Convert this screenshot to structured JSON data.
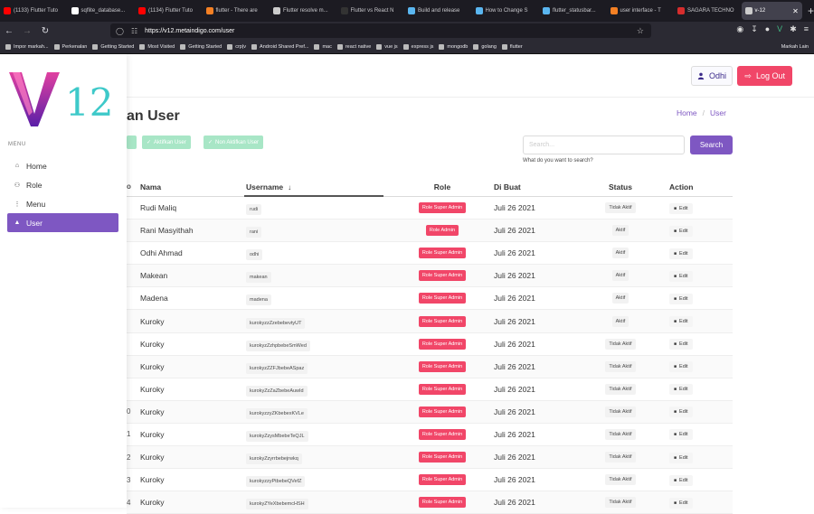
{
  "browser": {
    "tabs": [
      {
        "label": "(1133) Flutter Tuto",
        "color": "#ff0000"
      },
      {
        "label": "sqflite_database...",
        "color": "#ffffff"
      },
      {
        "label": "(1134) Flutter Tuto",
        "color": "#ff0000"
      },
      {
        "label": "flutter - There are",
        "color": "#f48024"
      },
      {
        "label": "Flutter resolve m...",
        "color": "#cccccc"
      },
      {
        "label": "Flutter vs React N",
        "color": "#333333"
      },
      {
        "label": "Build and release",
        "color": "#5ab6f0"
      },
      {
        "label": "How to Change S",
        "color": "#5ab6f0"
      },
      {
        "label": "flutter_statusbar...",
        "color": "#5ab6f0"
      },
      {
        "label": "user interface - T",
        "color": "#f48024"
      },
      {
        "label": "SAGARA TECHNO",
        "color": "#d62d2d"
      },
      {
        "label": "v-12",
        "color": "#cccccc",
        "active": true
      }
    ],
    "url": "https://v12.metaindigo.com/user",
    "bookmarks": [
      "Impor markah...",
      "Perkenalan",
      "Getting Started",
      "Most Visited",
      "Getting Started",
      "crp|v",
      "Android Shared Pref...",
      "mac",
      "react native",
      "vue js",
      "express js",
      "mongodb",
      "golang",
      "flutter"
    ],
    "bookmarks_other": "Markah Lain"
  },
  "brand": {
    "logo_text": "V12"
  },
  "header": {
    "user_label": "Odhi",
    "logout_label": "Log Out"
  },
  "sidebar": {
    "menu_label": "MENU",
    "items": [
      {
        "label": "Home",
        "icon": "home-icon",
        "active": false
      },
      {
        "label": "Role",
        "icon": "role-icon",
        "active": false
      },
      {
        "label": "Menu",
        "icon": "menu-dots-icon",
        "active": false
      },
      {
        "label": "User",
        "icon": "user-icon",
        "active": true
      }
    ]
  },
  "page": {
    "title": "an User",
    "breadcrumb": [
      "Home",
      "User"
    ],
    "actions": [
      "",
      "Aktifkan User",
      "Non Aktifkan User"
    ],
    "search_placeholder": "Search...",
    "search_button": "Search",
    "search_help": "What do you want to search?"
  },
  "table": {
    "columns": [
      "o",
      "Nama",
      "Username",
      "Role",
      "Di Buat",
      "Status",
      "Action"
    ],
    "rows": [
      {
        "no": "",
        "nama": "Rudi Maliq",
        "username": "rudi",
        "role": "Role Super Admin",
        "dibuat": "Juli 26 2021",
        "status": "Tidak Aktif",
        "action": "Edit"
      },
      {
        "no": "",
        "nama": "Rani Masyithah",
        "username": "rani",
        "role": "Role Admin",
        "dibuat": "Juli 26 2021",
        "status": "Aktif",
        "action": "Edit"
      },
      {
        "no": "",
        "nama": "Odhi Ahmad",
        "username": "odhi",
        "role": "Role Super Admin",
        "dibuat": "Juli 26 2021",
        "status": "Aktif",
        "action": "Edit"
      },
      {
        "no": "",
        "nama": "Makean",
        "username": "makean",
        "role": "Role Super Admin",
        "dibuat": "Juli 26 2021",
        "status": "Aktif",
        "action": "Edit"
      },
      {
        "no": "",
        "nama": "Madena",
        "username": "madena",
        "role": "Role Super Admin",
        "dibuat": "Juli 26 2021",
        "status": "Aktif",
        "action": "Edit"
      },
      {
        "no": "",
        "nama": "Kuroky",
        "username": "kurokyzzZzebebevtyUT",
        "role": "Role Super Admin",
        "dibuat": "Juli 26 2021",
        "status": "Aktif",
        "action": "Edit"
      },
      {
        "no": "",
        "nama": "Kuroky",
        "username": "kurokyzZzhpbebeSmWed",
        "role": "Role Super Admin",
        "dibuat": "Juli 26 2021",
        "status": "Tidak Aktif",
        "action": "Edit"
      },
      {
        "no": "",
        "nama": "Kuroky",
        "username": "kurokyzZZFJbebeASpaz",
        "role": "Role Super Admin",
        "dibuat": "Juli 26 2021",
        "status": "Tidak Aktif",
        "action": "Edit"
      },
      {
        "no": "",
        "nama": "Kuroky",
        "username": "kurokyZzZaZbebeAuwId",
        "role": "Role Super Admin",
        "dibuat": "Juli 26 2021",
        "status": "Tidak Aktif",
        "action": "Edit"
      },
      {
        "no": "0",
        "nama": "Kuroky",
        "username": "kurokyzzyZKbebexKVLe",
        "role": "Role Super Admin",
        "dibuat": "Juli 26 2021",
        "status": "Tidak Aktif",
        "action": "Edit"
      },
      {
        "no": "1",
        "nama": "Kuroky",
        "username": "kurokyZzysMbebeTeQJL",
        "role": "Role Super Admin",
        "dibuat": "Juli 26 2021",
        "status": "Tidak Aktif",
        "action": "Edit"
      },
      {
        "no": "2",
        "nama": "Kuroky",
        "username": "kurokyZzyrrbebejrwkq",
        "role": "Role Super Admin",
        "dibuat": "Juli 26 2021",
        "status": "Tidak Aktif",
        "action": "Edit"
      },
      {
        "no": "3",
        "nama": "Kuroky",
        "username": "kurokyzzyPtbebeQVefZ",
        "role": "Role Super Admin",
        "dibuat": "Juli 26 2021",
        "status": "Tidak Aktif",
        "action": "Edit"
      },
      {
        "no": "4",
        "nama": "Kuroky",
        "username": "kurokyZYeXbebemcHSH",
        "role": "Role Super Admin",
        "dibuat": "Juli 26 2021",
        "status": "Tidak Aktif",
        "action": "Edit"
      }
    ]
  },
  "colors": {
    "accent": "#7e57c2",
    "danger": "#f14668",
    "success_light": "#a8e6c6"
  }
}
